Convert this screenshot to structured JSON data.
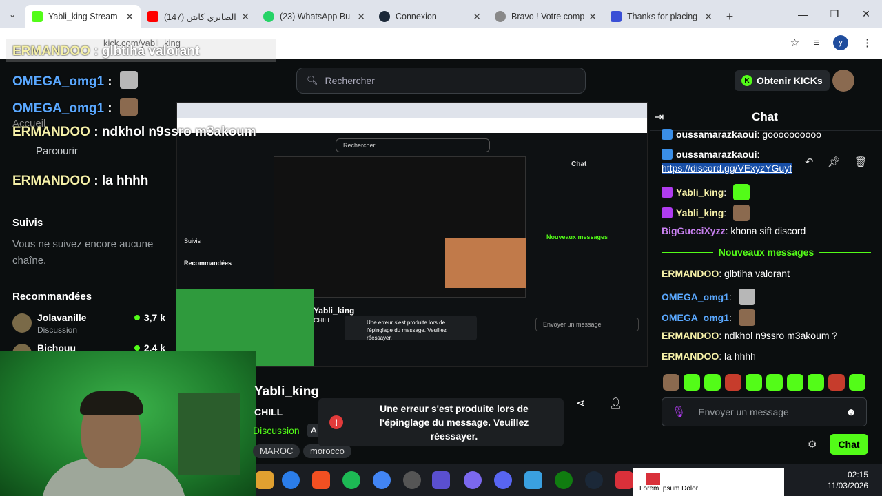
{
  "browser": {
    "tabs": [
      {
        "title": "Yabli_king Stream",
        "color": "#53fc18",
        "active": true
      },
      {
        "title": "(147) الصايري كابتن",
        "color": "#ff0000",
        "active": false
      },
      {
        "title": "(23) WhatsApp Bu",
        "color": "#25d366",
        "active": false
      },
      {
        "title": "Connexion",
        "color": "#1b2838",
        "active": false
      },
      {
        "title": "Bravo ! Votre comp",
        "color": "#888888",
        "active": false
      },
      {
        "title": "Thanks for placing",
        "color": "#3a4fd6",
        "active": false
      }
    ],
    "url": "kick.com/yabli_king",
    "profile_initial": "y"
  },
  "overlay_chat": [
    {
      "user": "ERMANDOO",
      "message": "glbtiha valorant",
      "user_color": "u1"
    },
    {
      "user": "OMEGA_omg1",
      "message": "",
      "user_color": "u2",
      "emote": true
    },
    {
      "user": "OMEGA_omg1",
      "message": "",
      "user_color": "u2",
      "emote": true
    },
    {
      "user": "ERMANDOO",
      "message": "ndkhol n9ssro m3akoum",
      "user_color": "u1"
    },
    {
      "user": "ERMANDOO",
      "message": "la hhhh",
      "user_color": "u1"
    }
  ],
  "header": {
    "search_placeholder": "Rechercher",
    "kicks_label": "Obtenir KICKs"
  },
  "sidebar": {
    "home": "Accueil",
    "browse": "Parcourir",
    "following_title": "Suivis",
    "following_empty": "Vous ne suivez encore aucune chaîne.",
    "recommended_title": "Recommandées",
    "recommended": [
      {
        "name": "Jolavanille",
        "category": "Discussion",
        "viewers": "3,7 k"
      },
      {
        "name": "Bichouu",
        "category": "",
        "viewers": "2,4 k"
      }
    ]
  },
  "stream": {
    "name": "Yabli_king",
    "title": "CHILL",
    "category": "Discussion",
    "tags": [
      "MAROC",
      "morocco"
    ]
  },
  "error_toast": "Une erreur s'est produite lors de l'épinglage du message. Veuillez réessayer.",
  "chat": {
    "title": "Chat",
    "new_messages_label": "Nouveaux messages",
    "input_placeholder": "Envoyer un message",
    "send_label": "Chat",
    "messages": [
      {
        "user": "oussamarazkaoui",
        "text": "goooooooooo",
        "user_color": "#ffffff"
      },
      {
        "user": "oussamarazkaoui",
        "text": "",
        "user_color": "#ffffff"
      },
      {
        "user": "",
        "text": "https://discord.gg/VExyzYGuyf",
        "user_color": "#ffffff",
        "link": true
      },
      {
        "user": "Yabli_king",
        "text": "",
        "user_color": "#f5f0a8",
        "emote": true
      },
      {
        "user": "Yabli_king",
        "text": "",
        "user_color": "#f5f0a8",
        "emote": true
      },
      {
        "user": "BigGucciXyzz",
        "text": "khona sift discord",
        "user_color": "#c880f0"
      },
      {
        "user": "ERMANDOO",
        "text": "glbtiha valorant",
        "user_color": "#f5f0a8"
      },
      {
        "user": "OMEGA_omg1",
        "text": "",
        "user_color": "#5aa8ff",
        "emote": true
      },
      {
        "user": "OMEGA_omg1",
        "text": "",
        "user_color": "#5aa8ff",
        "emote": true
      },
      {
        "user": "ERMANDOO",
        "text": "ndkhol n9ssro m3akoum ?",
        "user_color": "#f5f0a8"
      },
      {
        "user": "ERMANDOO",
        "text": "la hhhh",
        "user_color": "#f5f0a8"
      }
    ]
  },
  "taskbar": {
    "time": "02:15",
    "date": "11/03/2026",
    "lorem": "Lorem Ipsum Dolor"
  },
  "icons": [
    "menu-icon",
    "close-icon",
    "plus-icon",
    "minimize-icon",
    "maximize-icon",
    "star-icon",
    "media-icon",
    "search-icon",
    "mic-icon",
    "smile-icon",
    "gear-icon",
    "share-icon",
    "follow-icon",
    "undo-icon",
    "pin-icon",
    "trash-icon"
  ]
}
